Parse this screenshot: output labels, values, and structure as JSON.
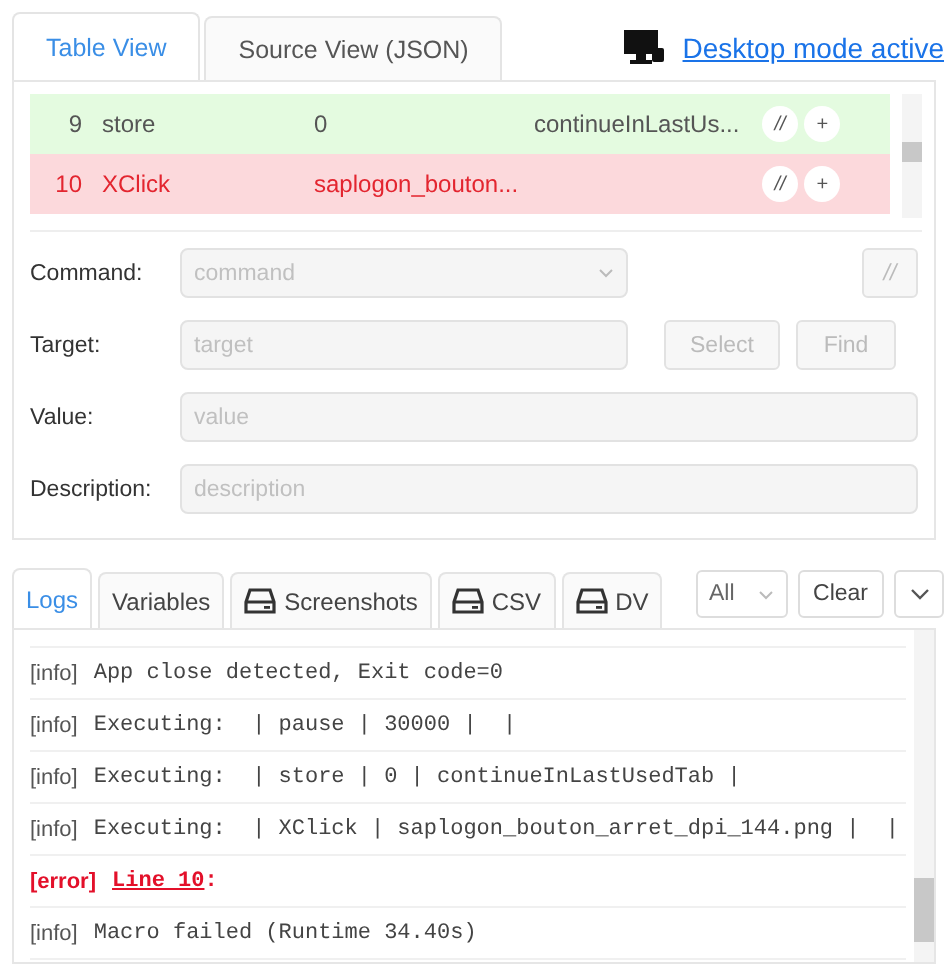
{
  "editor_tabs": [
    {
      "label": "Table View",
      "selected": true
    },
    {
      "label": "Source View (JSON)",
      "selected": false
    }
  ],
  "desktop_mode_link": "Desktop mode active",
  "table": {
    "rows": [
      {
        "index": "9",
        "command": "store",
        "target": "0",
        "value": "continueInLastUs...",
        "kind": "success",
        "comment_button": "//",
        "add_button": "+"
      },
      {
        "index": "10",
        "command": "XClick",
        "target": "saplogon_bouton...",
        "value": "",
        "kind": "error",
        "comment_button": "//",
        "add_button": "+"
      }
    ]
  },
  "form": {
    "command": {
      "label": "Command:",
      "placeholder": "command"
    },
    "comment_button": "//",
    "target": {
      "label": "Target:",
      "placeholder": "target"
    },
    "select_button": "Select",
    "find_button": "Find",
    "value": {
      "label": "Value:",
      "placeholder": "value"
    },
    "description": {
      "label": "Description:",
      "placeholder": "description"
    },
    "disabled": true
  },
  "bottom_tabs": [
    {
      "label": "Logs",
      "selected": true,
      "icon": false
    },
    {
      "label": "Variables",
      "selected": false,
      "icon": false
    },
    {
      "label": "Screenshots",
      "selected": false,
      "icon": true
    },
    {
      "label": "CSV",
      "selected": false,
      "icon": true
    },
    {
      "label": "DV",
      "selected": false,
      "icon": true
    }
  ],
  "log_filter": "All",
  "clear_button": "Clear",
  "logs": [
    {
      "level": "[info]",
      "kind": "info",
      "text": "App close detected, Exit code=0"
    },
    {
      "level": "[info]",
      "kind": "info",
      "text": "Executing:  | pause | 30000 |  |"
    },
    {
      "level": "[info]",
      "kind": "info",
      "text": "Executing:  | store | 0 | continueInLastUsedTab |"
    },
    {
      "level": "[info]",
      "kind": "info",
      "text": "Executing:  | XClick | saplogon_bouton_arret_dpi_144.png |  |"
    },
    {
      "level": "[error]",
      "kind": "error",
      "text": "Line 10",
      "suffix": ":"
    },
    {
      "level": "[info]",
      "kind": "info",
      "text": "Macro failed (Runtime 34.40s)"
    }
  ]
}
